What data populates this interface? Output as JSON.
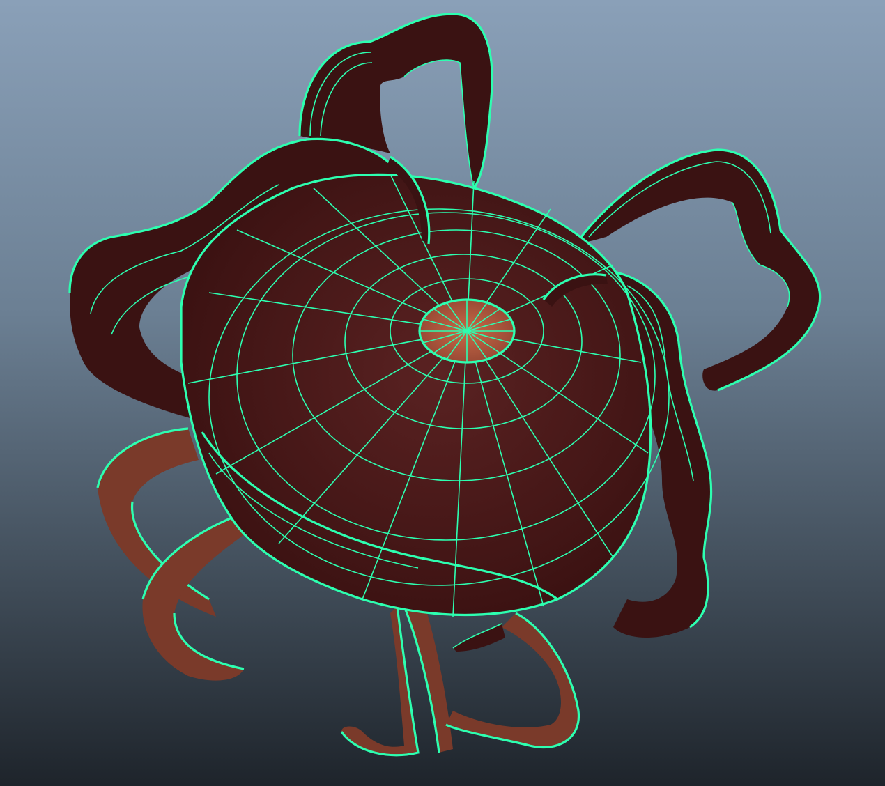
{
  "viewport": {
    "background_top": "#8aa0b8",
    "background_bottom": "#1e242b"
  },
  "model": {
    "surface_color": "#4b1a1a",
    "wire_color": "#2dffb0",
    "underside_color": "#7a3a2a",
    "display_mode": "wireframe-on-shaded"
  }
}
